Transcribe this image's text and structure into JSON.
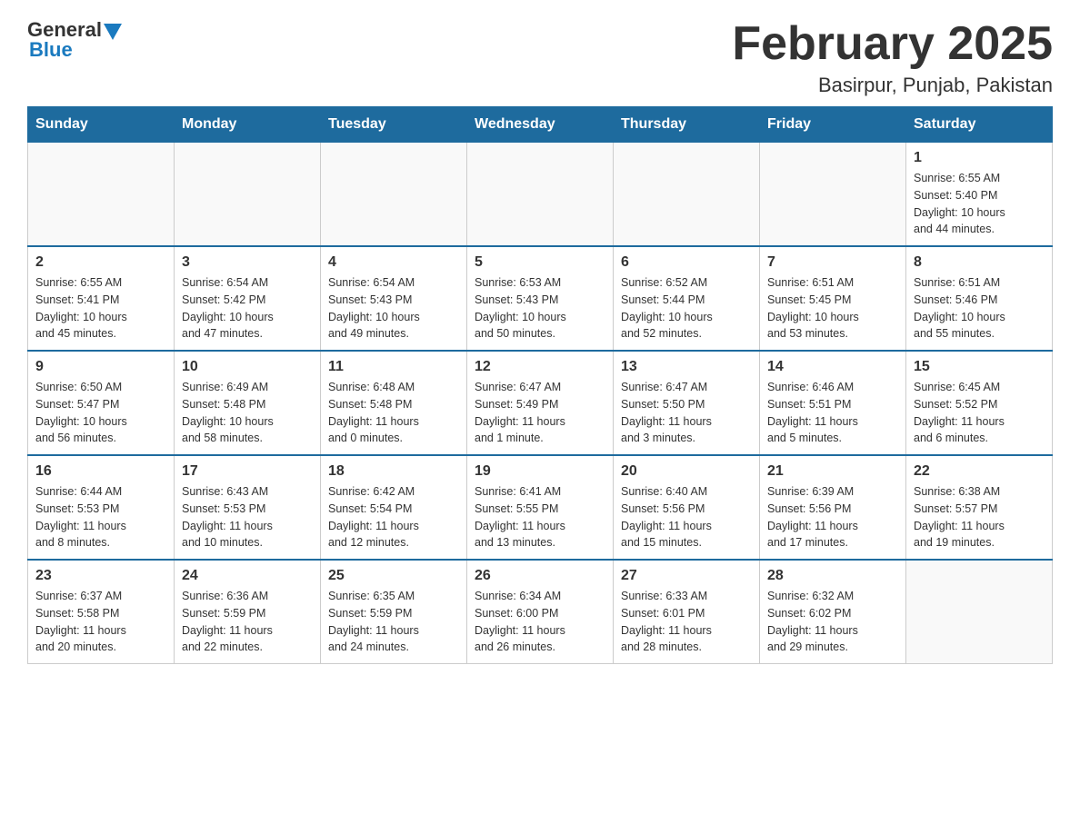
{
  "logo": {
    "general": "General",
    "blue": "Blue"
  },
  "header": {
    "title": "February 2025",
    "subtitle": "Basirpur, Punjab, Pakistan"
  },
  "weekdays": [
    "Sunday",
    "Monday",
    "Tuesday",
    "Wednesday",
    "Thursday",
    "Friday",
    "Saturday"
  ],
  "weeks": [
    [
      {
        "day": "",
        "info": ""
      },
      {
        "day": "",
        "info": ""
      },
      {
        "day": "",
        "info": ""
      },
      {
        "day": "",
        "info": ""
      },
      {
        "day": "",
        "info": ""
      },
      {
        "day": "",
        "info": ""
      },
      {
        "day": "1",
        "info": "Sunrise: 6:55 AM\nSunset: 5:40 PM\nDaylight: 10 hours\nand 44 minutes."
      }
    ],
    [
      {
        "day": "2",
        "info": "Sunrise: 6:55 AM\nSunset: 5:41 PM\nDaylight: 10 hours\nand 45 minutes."
      },
      {
        "day": "3",
        "info": "Sunrise: 6:54 AM\nSunset: 5:42 PM\nDaylight: 10 hours\nand 47 minutes."
      },
      {
        "day": "4",
        "info": "Sunrise: 6:54 AM\nSunset: 5:43 PM\nDaylight: 10 hours\nand 49 minutes."
      },
      {
        "day": "5",
        "info": "Sunrise: 6:53 AM\nSunset: 5:43 PM\nDaylight: 10 hours\nand 50 minutes."
      },
      {
        "day": "6",
        "info": "Sunrise: 6:52 AM\nSunset: 5:44 PM\nDaylight: 10 hours\nand 52 minutes."
      },
      {
        "day": "7",
        "info": "Sunrise: 6:51 AM\nSunset: 5:45 PM\nDaylight: 10 hours\nand 53 minutes."
      },
      {
        "day": "8",
        "info": "Sunrise: 6:51 AM\nSunset: 5:46 PM\nDaylight: 10 hours\nand 55 minutes."
      }
    ],
    [
      {
        "day": "9",
        "info": "Sunrise: 6:50 AM\nSunset: 5:47 PM\nDaylight: 10 hours\nand 56 minutes."
      },
      {
        "day": "10",
        "info": "Sunrise: 6:49 AM\nSunset: 5:48 PM\nDaylight: 10 hours\nand 58 minutes."
      },
      {
        "day": "11",
        "info": "Sunrise: 6:48 AM\nSunset: 5:48 PM\nDaylight: 11 hours\nand 0 minutes."
      },
      {
        "day": "12",
        "info": "Sunrise: 6:47 AM\nSunset: 5:49 PM\nDaylight: 11 hours\nand 1 minute."
      },
      {
        "day": "13",
        "info": "Sunrise: 6:47 AM\nSunset: 5:50 PM\nDaylight: 11 hours\nand 3 minutes."
      },
      {
        "day": "14",
        "info": "Sunrise: 6:46 AM\nSunset: 5:51 PM\nDaylight: 11 hours\nand 5 minutes."
      },
      {
        "day": "15",
        "info": "Sunrise: 6:45 AM\nSunset: 5:52 PM\nDaylight: 11 hours\nand 6 minutes."
      }
    ],
    [
      {
        "day": "16",
        "info": "Sunrise: 6:44 AM\nSunset: 5:53 PM\nDaylight: 11 hours\nand 8 minutes."
      },
      {
        "day": "17",
        "info": "Sunrise: 6:43 AM\nSunset: 5:53 PM\nDaylight: 11 hours\nand 10 minutes."
      },
      {
        "day": "18",
        "info": "Sunrise: 6:42 AM\nSunset: 5:54 PM\nDaylight: 11 hours\nand 12 minutes."
      },
      {
        "day": "19",
        "info": "Sunrise: 6:41 AM\nSunset: 5:55 PM\nDaylight: 11 hours\nand 13 minutes."
      },
      {
        "day": "20",
        "info": "Sunrise: 6:40 AM\nSunset: 5:56 PM\nDaylight: 11 hours\nand 15 minutes."
      },
      {
        "day": "21",
        "info": "Sunrise: 6:39 AM\nSunset: 5:56 PM\nDaylight: 11 hours\nand 17 minutes."
      },
      {
        "day": "22",
        "info": "Sunrise: 6:38 AM\nSunset: 5:57 PM\nDaylight: 11 hours\nand 19 minutes."
      }
    ],
    [
      {
        "day": "23",
        "info": "Sunrise: 6:37 AM\nSunset: 5:58 PM\nDaylight: 11 hours\nand 20 minutes."
      },
      {
        "day": "24",
        "info": "Sunrise: 6:36 AM\nSunset: 5:59 PM\nDaylight: 11 hours\nand 22 minutes."
      },
      {
        "day": "25",
        "info": "Sunrise: 6:35 AM\nSunset: 5:59 PM\nDaylight: 11 hours\nand 24 minutes."
      },
      {
        "day": "26",
        "info": "Sunrise: 6:34 AM\nSunset: 6:00 PM\nDaylight: 11 hours\nand 26 minutes."
      },
      {
        "day": "27",
        "info": "Sunrise: 6:33 AM\nSunset: 6:01 PM\nDaylight: 11 hours\nand 28 minutes."
      },
      {
        "day": "28",
        "info": "Sunrise: 6:32 AM\nSunset: 6:02 PM\nDaylight: 11 hours\nand 29 minutes."
      },
      {
        "day": "",
        "info": ""
      }
    ]
  ]
}
